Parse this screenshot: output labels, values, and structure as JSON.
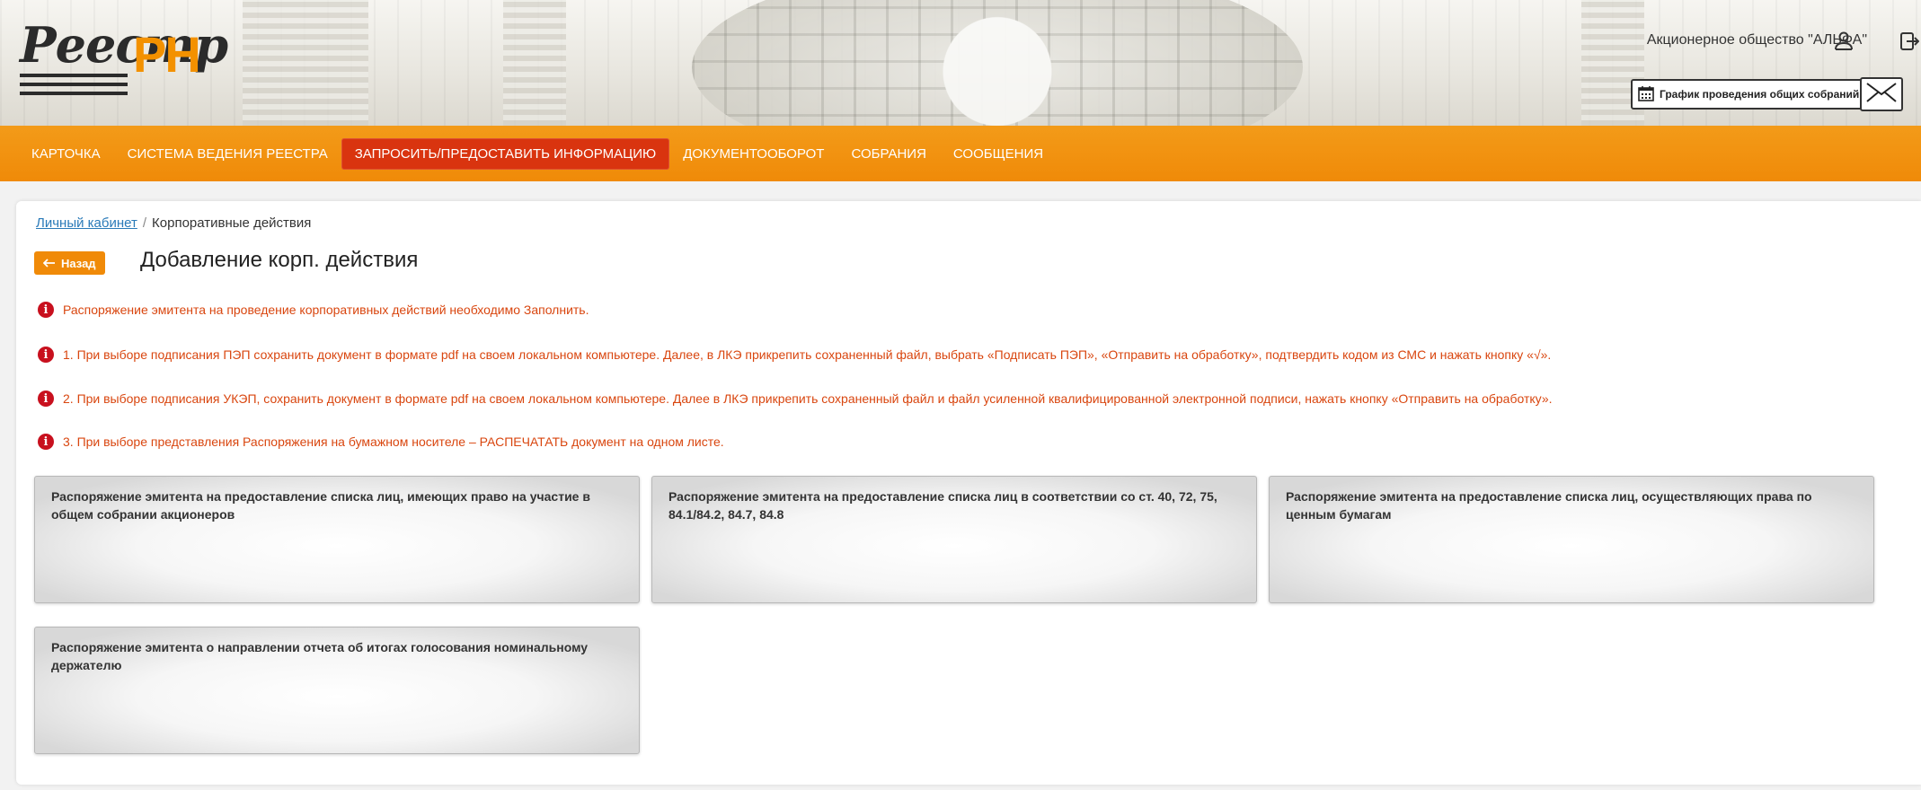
{
  "header": {
    "logo_text": "Реестр",
    "logo_mark": "РН",
    "company": "Акционерное общество \"АЛЬФА\"",
    "schedule_label": "График проведения общих собраний"
  },
  "nav": {
    "items": [
      {
        "label": "КАРТОЧКА"
      },
      {
        "label": "СИСТЕМА ВЕДЕНИЯ РЕЕСТРА"
      },
      {
        "label": "ЗАПРОСИТЬ/ПРЕДОСТАВИТЬ ИНФОРМАЦИЮ",
        "active": true
      },
      {
        "label": "ДОКУМЕНТООБОРОТ"
      },
      {
        "label": "СОБРАНИЯ"
      },
      {
        "label": "СООБЩЕНИЯ"
      }
    ]
  },
  "breadcrumb": {
    "home": "Личный кабинет",
    "separator": "/",
    "current": "Корпоративные действия"
  },
  "page": {
    "back_label": "Назад",
    "title": "Добавление корп. действия"
  },
  "notices": [
    "Распоряжение эмитента на проведение корпоративных действий необходимо Заполнить.",
    "1. При выборе подписания ПЭП сохранить документ в формате pdf на своем локальном компьютере. Далее, в ЛКЭ прикрепить сохраненный файл, выбрать «Подписать ПЭП», «Отправить на обработку», подтвердить кодом из СМС и нажать кнопку «√».",
    "2. При выборе подписания УКЭП, сохранить документ в формате pdf на своем локальном компьютере. Далее в ЛКЭ прикрепить сохраненный файл и файл усиленной квалифицированной электронной подписи, нажать кнопку «Отправить на обработку».",
    "3. При выборе представления Распоряжения на бумажном носителе – РАСПЕЧАТАТЬ документ на одном листе."
  ],
  "cards": [
    "Распоряжение эмитента на предоставление списка лиц, имеющих право на участие в общем собрании акционеров",
    "Распоряжение эмитента на предоставление списка лиц в соответствии со ст. 40, 72, 75, 84.1/84.2, 84.7, 84.8",
    "Распоряжение эмитента на предоставление списка лиц, осуществляющих права по ценным бумагам",
    "Распоряжение эмитента о направлении отчета об итогах голосования номинальному держателю"
  ],
  "colors": {
    "accent": "#f08a08",
    "nav_active": "#d9340f",
    "notice_text": "#d9460f",
    "link": "#2a7ab8"
  }
}
